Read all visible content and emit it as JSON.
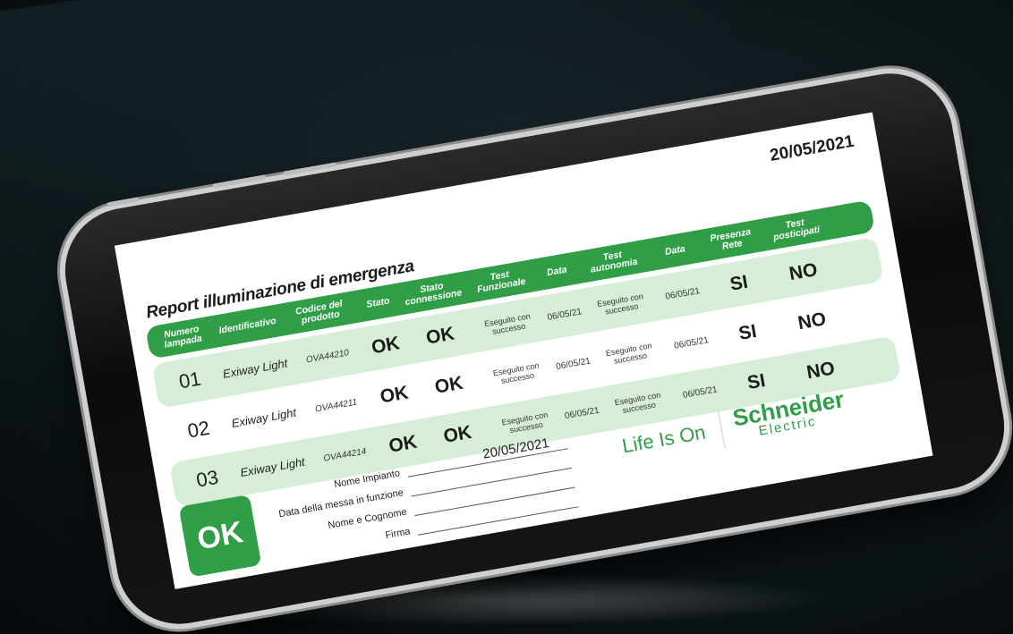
{
  "report": {
    "date": "20/05/2021",
    "title": "Report illuminazione di emergenza",
    "columns": [
      "Numero lampada",
      "Identificativo",
      "Codice del prodotto",
      "Stato",
      "Stato connessione",
      "Test Funzionale",
      "Data",
      "Test autonomia",
      "Data",
      "Presenza Rete",
      "Test posticipati"
    ],
    "rows": [
      {
        "num": "01",
        "id": "Exiway Light",
        "code": "OVA44210",
        "stato": "OK",
        "conn": "OK",
        "test_funz": "Eseguito con successo",
        "data1": "06/05/21",
        "test_aut": "Eseguito con successo",
        "data2": "06/05/21",
        "rete": "SI",
        "post": "NO"
      },
      {
        "num": "02",
        "id": "Exiway Light",
        "code": "OVA44211",
        "stato": "OK",
        "conn": "OK",
        "test_funz": "Eseguito con successo",
        "data1": "06/05/21",
        "test_aut": "Eseguito con successo",
        "data2": "06/05/21",
        "rete": "SI",
        "post": "NO"
      },
      {
        "num": "03",
        "id": "Exiway Light",
        "code": "OVA44214",
        "stato": "OK",
        "conn": "OK",
        "test_funz": "Eseguito con successo",
        "data1": "06/05/21",
        "test_aut": "Eseguito con successo",
        "data2": "06/05/21",
        "rete": "SI",
        "post": "NO"
      }
    ]
  },
  "status_badge": "OK",
  "form": {
    "nome_impianto_label": "Nome Impianto",
    "nome_impianto_value": "20/05/2021",
    "data_messa_label": "Data della messa in funzione",
    "nome_cognome_label": "Nome e Cognome",
    "firma_label": "Firma"
  },
  "brand": {
    "tagline": "Life Is On",
    "logo_line1": "Schneider",
    "logo_line2": "Electric"
  },
  "colors": {
    "accent_green": "#2f9e47",
    "row_shade": "#d6eed7",
    "background": "#0d1518"
  }
}
